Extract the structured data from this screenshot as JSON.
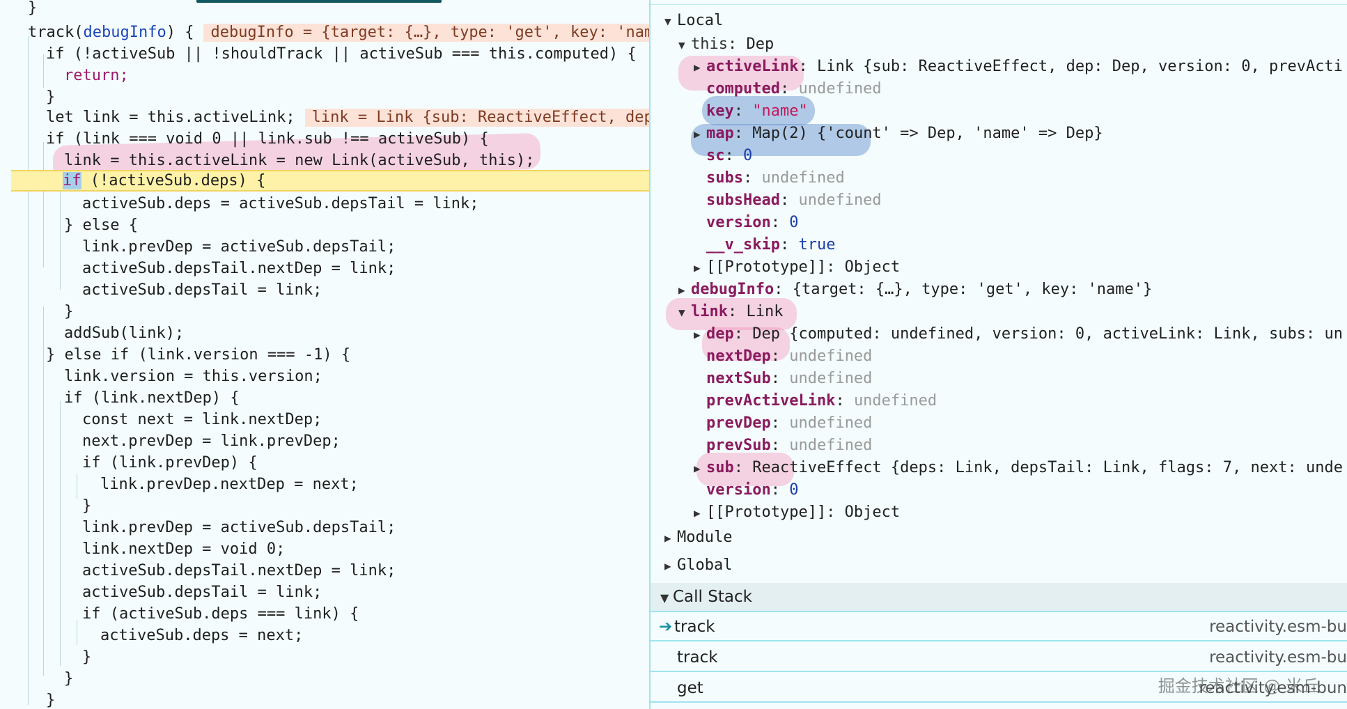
{
  "editor": {
    "lines": [
      {
        "id": "l0",
        "text": "}"
      },
      {
        "id": "l1",
        "kw": "",
        "pre": "track(",
        "fn": "debugInfo",
        "post": ") {",
        "inline": "debugInfo = {target: {…}, type: 'get', key: 'name'"
      },
      {
        "id": "l2",
        "text": "if (!activeSub || !shouldTrack || activeSub === this.computed) {"
      },
      {
        "id": "l3",
        "text": "return;"
      },
      {
        "id": "l4",
        "text": "}"
      },
      {
        "id": "l5",
        "text": "let link = this.activeLink;",
        "inline": "link = Link {sub: ReactiveEffect, dep"
      },
      {
        "id": "l6",
        "text": "if (link === void 0 || link.sub !== activeSub) {"
      },
      {
        "id": "l7",
        "text": "link = this.activeLink = new Link(activeSub, this);"
      },
      {
        "id": "l8",
        "kw": "if",
        "text": " (!activeSub.deps) {"
      },
      {
        "id": "l9",
        "text": "activeSub.deps = activeSub.depsTail = link;"
      },
      {
        "id": "l10",
        "text": "} else {"
      },
      {
        "id": "l11",
        "text": "link.prevDep = activeSub.depsTail;"
      },
      {
        "id": "l12",
        "text": "activeSub.depsTail.nextDep = link;"
      },
      {
        "id": "l13",
        "text": "activeSub.depsTail = link;"
      },
      {
        "id": "l14",
        "text": "}"
      },
      {
        "id": "l15",
        "text": "addSub(link);"
      },
      {
        "id": "l16",
        "text": "} else if (link.version === -1) {"
      },
      {
        "id": "l17",
        "text": "link.version = this.version;"
      },
      {
        "id": "l18",
        "text": "if (link.nextDep) {"
      },
      {
        "id": "l19",
        "text": "const next = link.nextDep;"
      },
      {
        "id": "l20",
        "text": "next.prevDep = link.prevDep;"
      },
      {
        "id": "l21",
        "text": "if (link.prevDep) {"
      },
      {
        "id": "l22",
        "text": "link.prevDep.nextDep = next;"
      },
      {
        "id": "l23",
        "text": "}"
      },
      {
        "id": "l24",
        "text": "link.prevDep = activeSub.depsTail;"
      },
      {
        "id": "l25",
        "text": "link.nextDep = void 0;"
      },
      {
        "id": "l26",
        "text": "activeSub.depsTail.nextDep = link;"
      },
      {
        "id": "l27",
        "text": "activeSub.depsTail = link;"
      },
      {
        "id": "l28",
        "text": "if (activeSub.deps === link) {"
      },
      {
        "id": "l29",
        "text": "activeSub.deps = next;"
      },
      {
        "id": "l30",
        "text": "}"
      },
      {
        "id": "l31",
        "text": "}"
      },
      {
        "id": "l32",
        "text": "}"
      }
    ]
  },
  "scope": {
    "local_label": "Local",
    "this_label": "this",
    "this_type": "Dep",
    "activeLink_key": "activeLink",
    "activeLink_val": "Link {sub: ReactiveEffect, dep: Dep, version: 0, prevActi",
    "computed_key": "computed",
    "computed_val": "undefined",
    "key_key": "key",
    "key_val": "\"name\"",
    "map_key": "map",
    "map_val": "Map(2) {'count' => Dep, 'name' => Dep}",
    "sc_key": "sc",
    "sc_val": "0",
    "subs_key": "subs",
    "subs_val": "undefined",
    "subsHead_key": "subsHead",
    "subsHead_val": "undefined",
    "version_key": "version",
    "version_val": "0",
    "vskip_key": "__v_skip",
    "vskip_val": "true",
    "proto_label": "[[Prototype]]: Object",
    "debugInfo_key": "debugInfo",
    "debugInfo_val": "{target: {…}, type: 'get', key: 'name'}",
    "link_key": "link",
    "link_type": "Link",
    "dep_key": "dep",
    "dep_val": "Dep {computed: undefined, version: 0, activeLink: Link, subs: un",
    "nextDep_key": "nextDep",
    "nextDep_val": "undefined",
    "nextSub_key": "nextSub",
    "nextSub_val": "undefined",
    "prevActiveLink_key": "prevActiveLink",
    "prevActiveLink_val": "undefined",
    "prevDep_key": "prevDep",
    "prevDep_val": "undefined",
    "prevSub_key": "prevSub",
    "prevSub_val": "undefined",
    "sub_key": "sub",
    "sub_val": "ReactiveEffect {deps: Link, depsTail: Link, flags: 7, next: unde",
    "link_version_key": "version",
    "link_version_val": "0",
    "proto2_label": "[[Prototype]]: Object",
    "module_label": "Module",
    "global_label": "Global"
  },
  "callstack": {
    "header": "Call Stack",
    "frames": [
      {
        "name": "track",
        "file": "reactivity.esm-bu"
      },
      {
        "name": "track",
        "file": "reactivity.esm-bu"
      },
      {
        "name": "get",
        "file": "reactivity.esm-bun"
      }
    ]
  },
  "watermark": "掘金技术社区 @ 米丘"
}
